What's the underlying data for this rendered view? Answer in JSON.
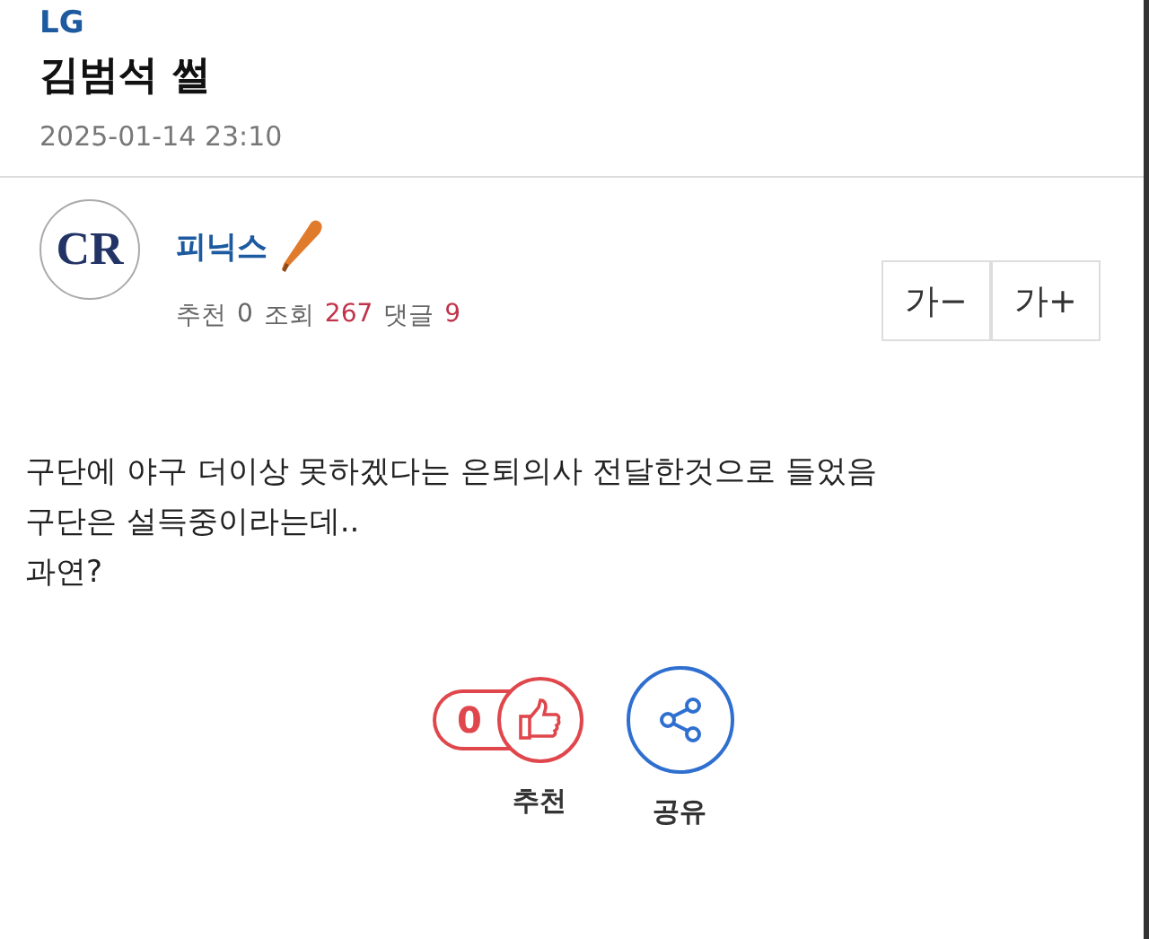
{
  "post": {
    "category": "LG",
    "title": "김범석 썰",
    "date": "2025-01-14 23:10"
  },
  "author": {
    "avatar_text": "CR",
    "name": "피닉스"
  },
  "stats": [
    {
      "label": "추천",
      "value": "0",
      "highlighted": false
    },
    {
      "label": "조회",
      "value": "267",
      "highlighted": true
    },
    {
      "label": "댓글",
      "value": "9",
      "highlighted": true
    }
  ],
  "font_buttons": [
    "가−",
    "가+"
  ],
  "body": [
    "구단에 야구 더이상 못하겠다는 은퇴의사 전달한것으로 들었음",
    "구단은 설득중이라는데..",
    "과연?"
  ],
  "actions": {
    "recommend_count": "0",
    "recommend_label": "추천",
    "share_label": "공유"
  }
}
